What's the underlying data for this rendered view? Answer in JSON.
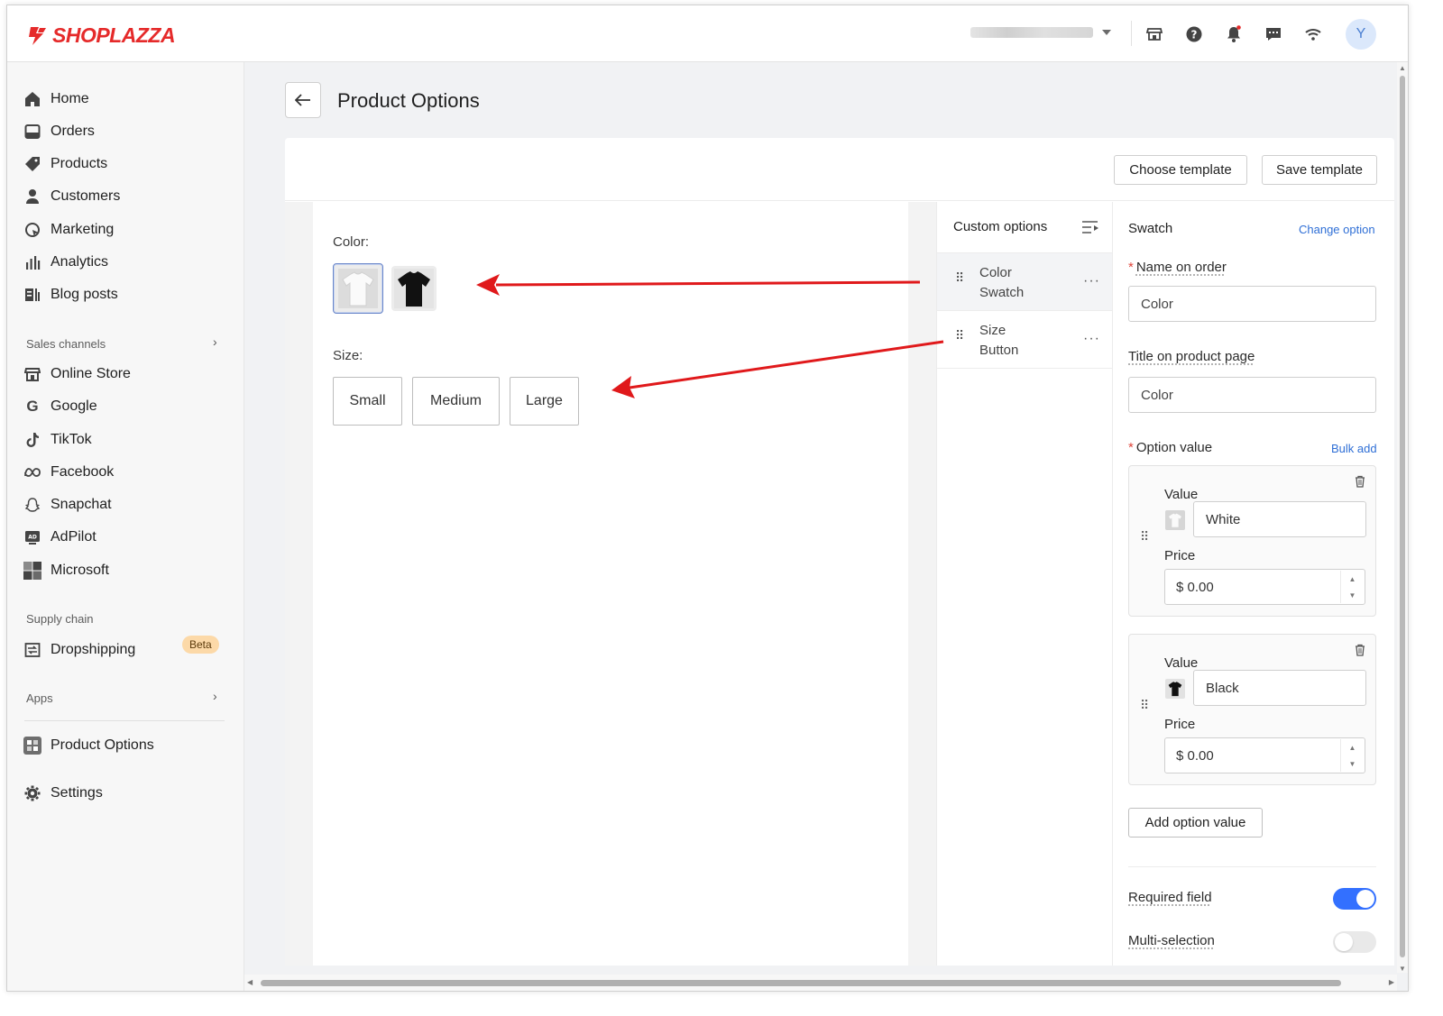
{
  "brand": {
    "name": "SHOPLAZZA",
    "color": "#e52a2a"
  },
  "topbar": {
    "icons": [
      "store-icon",
      "help-icon",
      "bell-icon",
      "chat-icon",
      "wifi-icon"
    ],
    "avatar_letter": "Y"
  },
  "sidebar": {
    "items": [
      {
        "label": "Home",
        "icon": "home-icon"
      },
      {
        "label": "Orders",
        "icon": "orders-icon"
      },
      {
        "label": "Products",
        "icon": "tag-icon"
      },
      {
        "label": "Customers",
        "icon": "person-icon"
      },
      {
        "label": "Marketing",
        "icon": "marketing-icon"
      },
      {
        "label": "Analytics",
        "icon": "bar-chart-icon"
      },
      {
        "label": "Blog posts",
        "icon": "blog-icon"
      }
    ],
    "sales_channels_label": "Sales channels",
    "channels": [
      {
        "label": "Online Store",
        "icon": "store-icon"
      },
      {
        "label": "Google",
        "icon": "google-icon"
      },
      {
        "label": "TikTok",
        "icon": "tiktok-icon"
      },
      {
        "label": "Facebook",
        "icon": "meta-icon"
      },
      {
        "label": "Snapchat",
        "icon": "snapchat-icon"
      },
      {
        "label": "AdPilot",
        "icon": "adpilot-icon"
      },
      {
        "label": "Microsoft",
        "icon": "microsoft-icon"
      }
    ],
    "supply_chain_label": "Supply chain",
    "dropshipping": {
      "label": "Dropshipping",
      "badge": "Beta"
    },
    "apps_label": "Apps",
    "product_options": "Product Options",
    "settings": "Settings"
  },
  "page": {
    "title": "Product Options"
  },
  "toolbar": {
    "choose_template": "Choose template",
    "save_template": "Save template"
  },
  "preview": {
    "color_label": "Color:",
    "swatches": [
      {
        "name": "White",
        "color": "#ffffff"
      },
      {
        "name": "Black",
        "color": "#111111"
      }
    ],
    "size_label": "Size:",
    "sizes": [
      "Small",
      "Medium",
      "Large"
    ]
  },
  "custom_options": {
    "title": "Custom options",
    "items": [
      {
        "line1": "Color",
        "line2": "Swatch"
      },
      {
        "line1": "Size",
        "line2": "Button"
      }
    ]
  },
  "settings_panel": {
    "title": "Swatch",
    "change_option": "Change option",
    "name_on_order_label": "Name on order",
    "name_on_order_value": "Color",
    "title_on_page_label": "Title on product page",
    "title_on_page_value": "Color",
    "option_value_label": "Option value",
    "bulk_add": "Bulk add",
    "values": [
      {
        "value_label": "Value",
        "value": "White",
        "price_label": "Price",
        "price": "$ 0.00"
      },
      {
        "value_label": "Value",
        "value": "Black",
        "price_label": "Price",
        "price": "$ 0.00"
      }
    ],
    "add_option_value": "Add option value",
    "required_field": {
      "label": "Required field",
      "on": true
    },
    "multi_selection": {
      "label": "Multi-selection",
      "on": false
    }
  },
  "colors": {
    "accent": "#3370ff",
    "annotation_arrow": "#e0191b",
    "link": "#2f6fd6"
  }
}
